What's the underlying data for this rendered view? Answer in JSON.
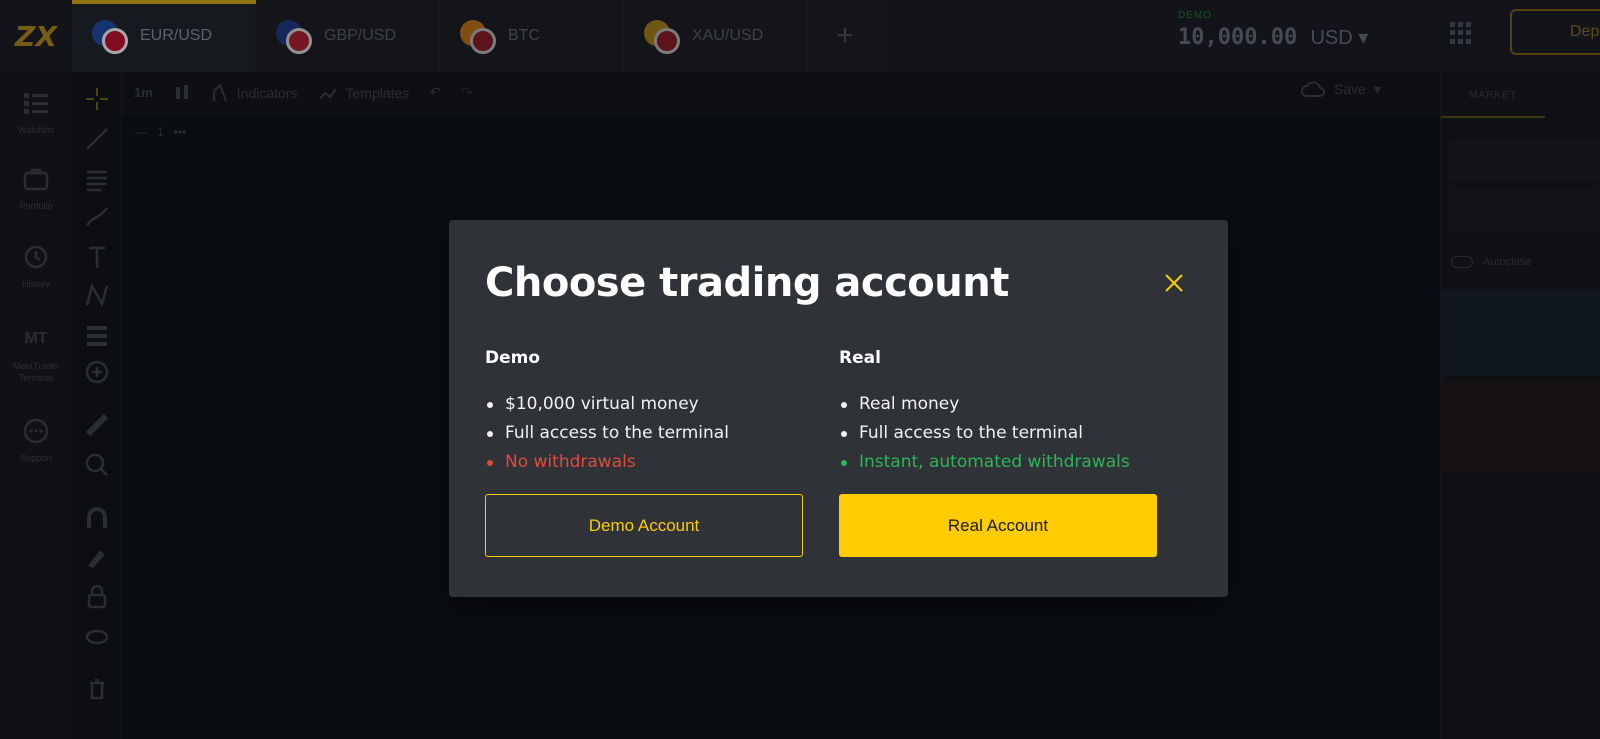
{
  "logo": {
    "text": "ZX"
  },
  "tabs": [
    {
      "label": "EUR/USD",
      "active": true,
      "flag_colors": [
        "#1f4fa8",
        "#c8102e"
      ]
    },
    {
      "label": "GBP/USD",
      "active": false,
      "flag_colors": [
        "#1f3a8a",
        "#b22234"
      ]
    },
    {
      "label": "BTC",
      "active": false,
      "flag_colors": [
        "#f7931a",
        "#b22234"
      ]
    },
    {
      "label": "XAU/USD",
      "active": false,
      "flag_colors": [
        "#d4a017",
        "#b22234"
      ]
    }
  ],
  "add_tab_label": "+",
  "account": {
    "mode": "DEMO",
    "amount": "10,000.00",
    "currency": "USD"
  },
  "deposit_label": "Dep",
  "left_nav": [
    {
      "label": "Watchlist",
      "icon": "list-icon"
    },
    {
      "label": "Portfolio",
      "icon": "briefcase-icon"
    },
    {
      "label": "History",
      "icon": "history-icon"
    },
    {
      "label": "MetaTrader Terminal",
      "icon": "mt-icon",
      "badge": "MT"
    },
    {
      "label": "Support",
      "icon": "chat-icon"
    }
  ],
  "chart_toolbar": {
    "timeframe": "1m",
    "indicators_label": "Indicators",
    "templates_label": "Templates",
    "save_label": "Save"
  },
  "right_panel": {
    "tab_label": "MARKET",
    "autoclose_label": "Autoclose"
  },
  "modal": {
    "title": "Choose trading account",
    "demo": {
      "heading": "Demo",
      "features": [
        {
          "text": "$10,000 virtual money",
          "tone": "normal"
        },
        {
          "text": "Full access to the terminal",
          "tone": "normal"
        },
        {
          "text": "No withdrawals",
          "tone": "negative"
        }
      ],
      "button_label": "Demo Account"
    },
    "real": {
      "heading": "Real",
      "features": [
        {
          "text": "Real money",
          "tone": "normal"
        },
        {
          "text": "Full access to the terminal",
          "tone": "normal"
        },
        {
          "text": "Instant, automated withdrawals",
          "tone": "positive"
        }
      ],
      "button_label": "Real Account"
    }
  },
  "colors": {
    "accent": "#ffcc00",
    "modal_bg": "#2f3236",
    "negative": "#e04a3c",
    "positive": "#2fb457"
  }
}
